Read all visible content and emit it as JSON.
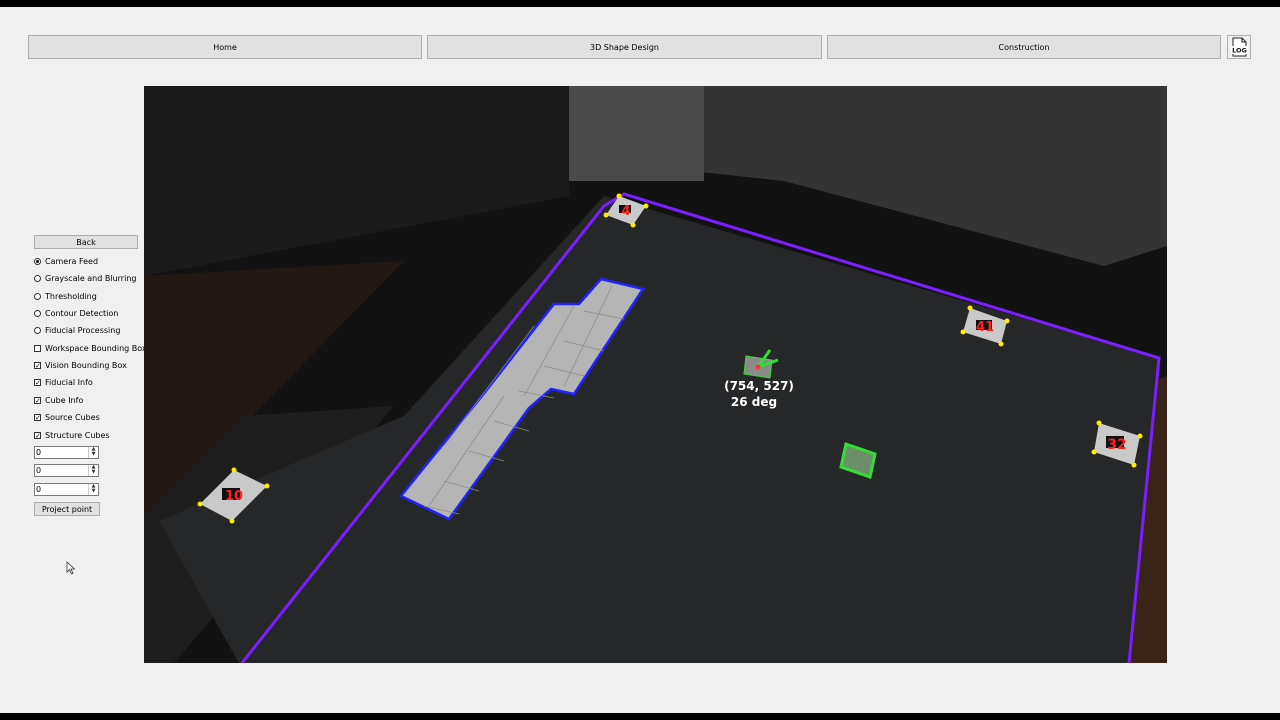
{
  "nav": {
    "home": "Home",
    "design": "3D Shape Design",
    "construction": "Construction",
    "log_label": "LOG",
    "log_icon": "log-file-icon"
  },
  "panel": {
    "back": "Back",
    "view_options": [
      {
        "label": "Camera Feed",
        "checked": true
      },
      {
        "label": "Grayscale and Blurring",
        "checked": false
      },
      {
        "label": "Thresholding",
        "checked": false
      },
      {
        "label": "Contour Detection",
        "checked": false
      },
      {
        "label": "Fiducial Processing",
        "checked": false
      }
    ],
    "overlay_options": [
      {
        "label": "Workspace Bounding Box",
        "checked": false
      },
      {
        "label": "Vision Bounding Box",
        "checked": true
      },
      {
        "label": "Fiducial Info",
        "checked": true
      },
      {
        "label": "Cube Info",
        "checked": true
      },
      {
        "label": "Source Cubes",
        "checked": true
      },
      {
        "label": "Structure Cubes",
        "checked": true
      }
    ],
    "spinboxes": [
      "0",
      "0",
      "0"
    ],
    "project_point": "Project point"
  },
  "camera": {
    "cube_position": "(754, 527)",
    "cube_angle": "26 deg",
    "fiducial_ids": [
      "4",
      "41",
      "32",
      "10"
    ],
    "colors": {
      "vision_box": "#7a1fff",
      "structure_outline": "#2222ff",
      "source_cube_outline": "#33dd33",
      "fiducial_corner": "#ffee00",
      "fiducial_id": "#ff2020"
    }
  }
}
